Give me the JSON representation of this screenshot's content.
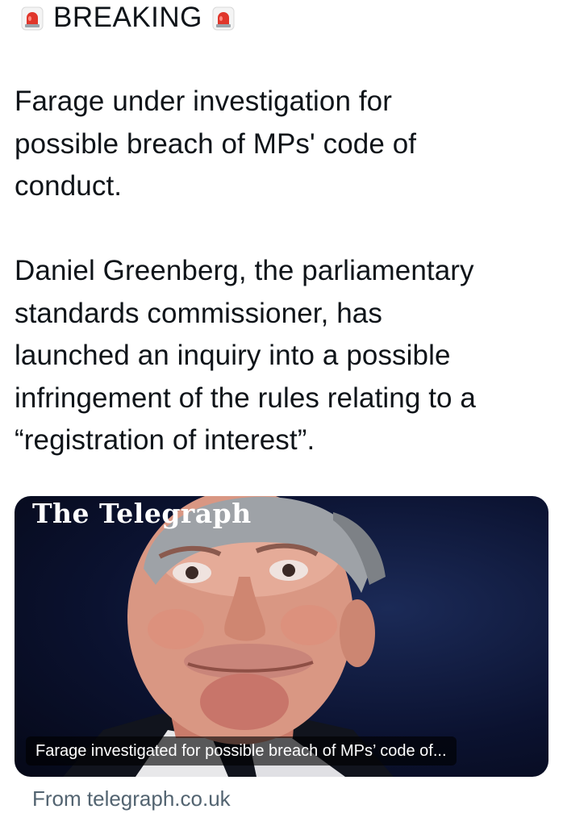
{
  "header": {
    "breaking_label": "BREAKING",
    "siren_icon": "rotating-light-icon",
    "siren_color": "#e0362b"
  },
  "tweet": {
    "text": "Farage under investigation for\npossible breach of MPs' code of\nconduct.\n\nDaniel Greenberg, the parliamentary\nstandards commissioner, has\nlaunched an inquiry into a possible\ninfringement of the rules relating to a\n“registration of interest”."
  },
  "link_card": {
    "masthead": "The Telegraph",
    "caption": "Farage investigated for possible breach of MPs’ code of...",
    "source": "From telegraph.co.uk",
    "image_description_icon": "news-photo"
  },
  "colors": {
    "text": "#0f1419",
    "muted": "#536471",
    "card_bg": "#0b1230"
  }
}
